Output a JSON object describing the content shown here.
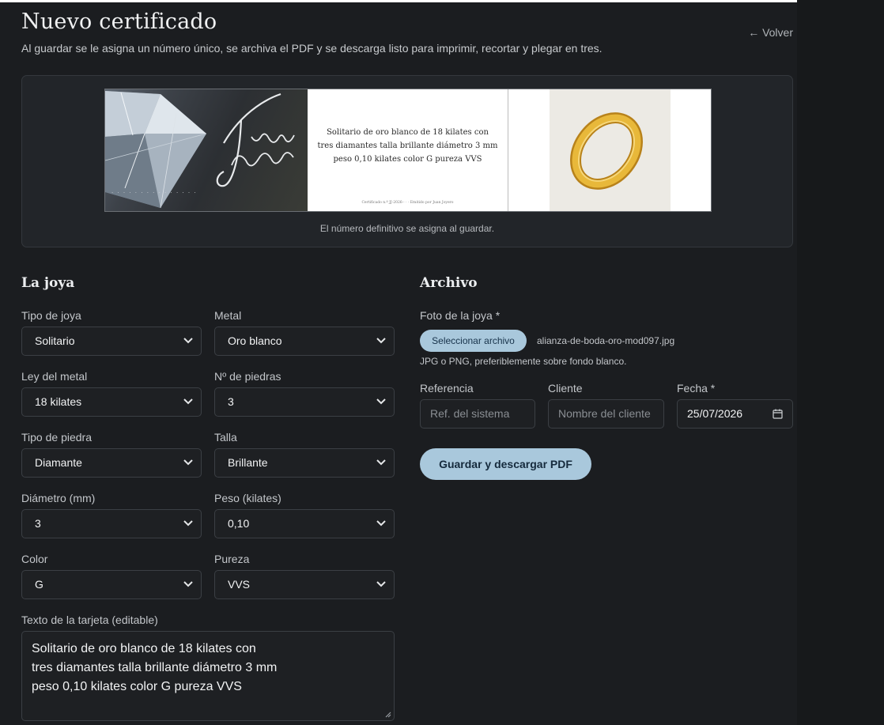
{
  "header": {
    "title": "Nuevo certificado",
    "subtitle": "Al guardar se le asigna un número único, se archiva el PDF y se descarga listo para imprimir, recortar y plegar en tres.",
    "back_label": "← Volver"
  },
  "preview": {
    "logo_text": "Juan Joyero",
    "card_text_lines": [
      "Solitario de oro blanco de 18 kilates con",
      "tres diamantes talla brillante diámetro 3 mm",
      "peso 0,10 kilates color G pureza VVS"
    ],
    "card_footer": "Certificado n.º JJ-2026-· · · Emitido por Juan Joyero",
    "note": "El número definitivo se asigna al guardar."
  },
  "jewel_section": {
    "title": "La joya",
    "fields": [
      {
        "label": "Tipo de joya",
        "value": "Solitario"
      },
      {
        "label": "Metal",
        "value": "Oro blanco"
      },
      {
        "label": "Ley del metal",
        "value": "18 kilates"
      },
      {
        "label": "Nº de piedras",
        "value": "3"
      },
      {
        "label": "Tipo de piedra",
        "value": "Diamante"
      },
      {
        "label": "Talla",
        "value": "Brillante"
      },
      {
        "label": "Diámetro (mm)",
        "value": "3"
      },
      {
        "label": "Peso (kilates)",
        "value": "0,10"
      },
      {
        "label": "Color",
        "value": "G"
      },
      {
        "label": "Pureza",
        "value": "VVS"
      }
    ],
    "text_label": "Texto de la tarjeta (editable)",
    "text_lines": [
      "Solitario de oro blanco de 18 kilates con",
      "tres diamantes talla brillante diámetro 3 mm",
      "peso 0,10 kilates color G pureza VVS"
    ]
  },
  "archive_section": {
    "title": "Archivo",
    "photo_label": "Foto de la joya *",
    "file_button": "Seleccionar archivo",
    "file_name": "alianza-de-boda-oro-mod097.jpg",
    "hint": "JPG o PNG, preferiblemente sobre fondo blanco.",
    "reference": {
      "label": "Referencia",
      "placeholder": "Ref. del sistema"
    },
    "client": {
      "label": "Cliente",
      "placeholder": "Nombre del cliente"
    },
    "date": {
      "label": "Fecha *",
      "value": "25/07/2026"
    },
    "save_button": "Guardar y descargar PDF"
  },
  "colors": {
    "background": "#1b1d20",
    "accent_button": "#a9c8dc",
    "ring_gold": "#d9a52a"
  }
}
